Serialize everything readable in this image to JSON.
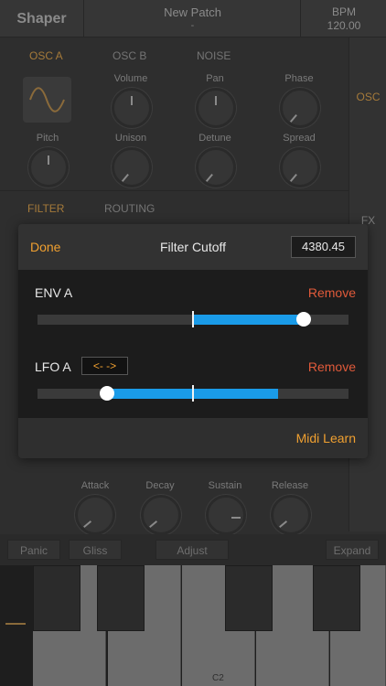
{
  "header": {
    "app_name": "Shaper",
    "patch_label": "New Patch",
    "patch_sub": "-",
    "bpm_label": "BPM",
    "bpm_value": "120.00"
  },
  "osc_tabs": [
    {
      "label": "OSC A",
      "active": true
    },
    {
      "label": "OSC B",
      "active": false
    },
    {
      "label": "NOISE",
      "active": false
    }
  ],
  "osc_knobs": [
    "Volume",
    "Pan",
    "Phase",
    "Pitch",
    "Unison",
    "Detune",
    "Spread"
  ],
  "filter_tabs": [
    {
      "label": "FILTER",
      "active": true
    },
    {
      "label": "ROUTING",
      "active": false
    }
  ],
  "side_tabs": {
    "osc": "OSC",
    "fx": "FX"
  },
  "envelope_knobs": [
    "Attack",
    "Decay",
    "Sustain",
    "Release"
  ],
  "bottom_buttons": {
    "panic": "Panic",
    "gliss": "Gliss",
    "adjust": "Adjust",
    "expand": "Expand"
  },
  "keyboard": {
    "octave_label": "C2"
  },
  "modal": {
    "done_label": "Done",
    "title": "Filter Cutoff",
    "value": "4380.45",
    "modulators": [
      {
        "name": "ENV A",
        "remove_label": "Remove",
        "amount_from": 0.0,
        "amount_to": 0.71
      },
      {
        "name": "LFO A",
        "remove_label": "Remove",
        "direction_label": "<- ->",
        "amount_from": -0.55,
        "amount_to": 0.55
      }
    ],
    "midi_learn_label": "Midi Learn"
  },
  "colors": {
    "accent": "#f0a030",
    "remove": "#e05a3a",
    "slider_fill": "#1a9be8"
  }
}
